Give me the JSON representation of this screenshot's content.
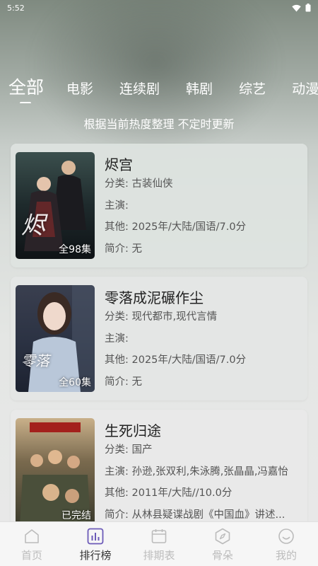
{
  "status_bar": {
    "time": "5:52",
    "icons": [
      "wifi-icon",
      "battery-icon"
    ]
  },
  "tabs": [
    {
      "label": "全部",
      "active": true
    },
    {
      "label": "电影"
    },
    {
      "label": "连续剧"
    },
    {
      "label": "韩剧"
    },
    {
      "label": "综艺"
    },
    {
      "label": "动漫"
    }
  ],
  "subtitle": "根据当前热度整理 不定时更新",
  "items": [
    {
      "title": "烬宫",
      "episodes": "全98集",
      "category_label": "分类:",
      "category": "古装仙侠",
      "cast_label": "主演:",
      "cast": "",
      "other_label": "其他:",
      "other": "2025年/大陆/国语/7.0分",
      "intro_label": "简介:",
      "intro": "无"
    },
    {
      "title": "零落成泥碾作尘",
      "episodes": "全60集",
      "category_label": "分类:",
      "category": "现代都市,现代言情",
      "cast_label": "主演:",
      "cast": "",
      "other_label": "其他:",
      "other": "2025年/大陆/国语/7.0分",
      "intro_label": "简介:",
      "intro": "无"
    },
    {
      "title": "生死归途",
      "episodes": "已完结",
      "category_label": "分类:",
      "category": "国产",
      "cast_label": "主演:",
      "cast": "孙逊,张双利,朱泳腾,张晶晶,冯嘉怡",
      "other_label": "其他:",
      "other": "2011年/大陆//10.0分",
      "intro_label": "简介:",
      "intro": "从林县疑谍战剧《中国血》讲述..."
    }
  ],
  "bottom_nav": [
    {
      "label": "首页",
      "icon": "home-icon"
    },
    {
      "label": "排行榜",
      "icon": "chart-icon",
      "active": true
    },
    {
      "label": "排期表",
      "icon": "calendar-icon"
    },
    {
      "label": "骨朵",
      "icon": "compass-icon"
    },
    {
      "label": "我的",
      "icon": "smile-icon"
    }
  ]
}
